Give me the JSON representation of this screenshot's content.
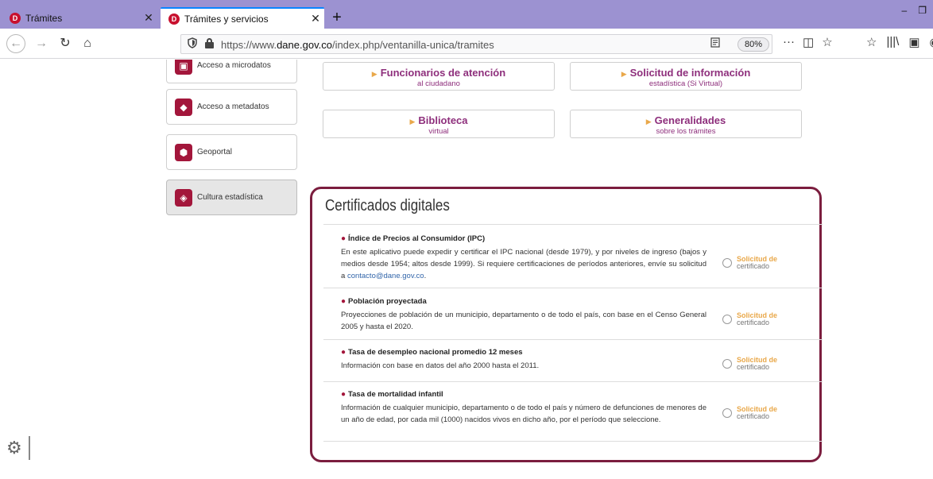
{
  "browser": {
    "tabs": [
      {
        "title": "Trámites",
        "favicon": "D",
        "close": "✕"
      },
      {
        "title": "Trámites y servicios",
        "favicon": "D",
        "close": "✕"
      }
    ],
    "new_tab": "+",
    "window_controls": {
      "minimize": "–",
      "restore": "❐"
    },
    "nav": {
      "back": "←",
      "forward": "→",
      "reload": "↻",
      "home": "⌂"
    },
    "url": {
      "prefix": "https://www.",
      "domain": "dane.gov.co",
      "path": "/index.php/ventanilla-unica/tramites"
    },
    "zoom": "80%",
    "page_actions": {
      "more": "···",
      "pocket": "◫",
      "bookmark": "☆"
    },
    "tools": {
      "bookmarks": "☆",
      "library": "|||\\",
      "sidebar": "▣",
      "account": "◉"
    },
    "shield_icon": "shield-icon",
    "accent": "#9c92d1"
  },
  "sidebar": [
    {
      "label": "Acceso a microdatos",
      "icon": "microdata-icon"
    },
    {
      "label": "Acceso a metadatos",
      "icon": "metadata-icon"
    },
    {
      "label": "Geoportal",
      "icon": "map-icon"
    },
    {
      "label": "Cultura estadística",
      "icon": "culture-icon"
    }
  ],
  "links": [
    {
      "title": "Funcionarios de atención",
      "subtitle": "al ciudadano"
    },
    {
      "title": "Solicitud de información",
      "subtitle": "estadística (Si Virtual)"
    },
    {
      "title": "Biblioteca",
      "subtitle": "virtual"
    },
    {
      "title": "Generalidades",
      "subtitle": "sobre los trámites"
    }
  ],
  "certificados": {
    "title": "Certificados digitales",
    "request_line1": "Solicitud de",
    "request_line2": "certificado",
    "items": [
      {
        "heading": "Índice de Precios al Consumidor (IPC)",
        "body": "En este aplicativo puede expedir y certificar el IPC nacional (desde 1979), y por niveles de ingreso (bajos y medios desde 1954; altos desde 1999). Si requiere certificaciones de períodos anteriores, envíe su solicitud a ",
        "link": "contacto@dane.gov.co",
        "body_end": "."
      },
      {
        "heading": "Población proyectada",
        "body": "Proyecciones de población de un municipio, departamento o de todo el país, con base en el Censo General 2005 y hasta el 2020."
      },
      {
        "heading": "Tasa de desempleo nacional promedio 12 meses",
        "body": "Información con base en datos del año 2000 hasta el 2011."
      },
      {
        "heading": "Tasa de mortalidad infantil",
        "body": "Información de cualquier municipio, departamento o de todo el país y número de defunciones de menores de un año de edad, por cada mil (1000) nacidos vivos en dicho año, por el período que seleccione."
      }
    ],
    "border_color": "#7b1d3e",
    "link_color": "#8e2f7c"
  },
  "gear_icon": "gear-icon"
}
